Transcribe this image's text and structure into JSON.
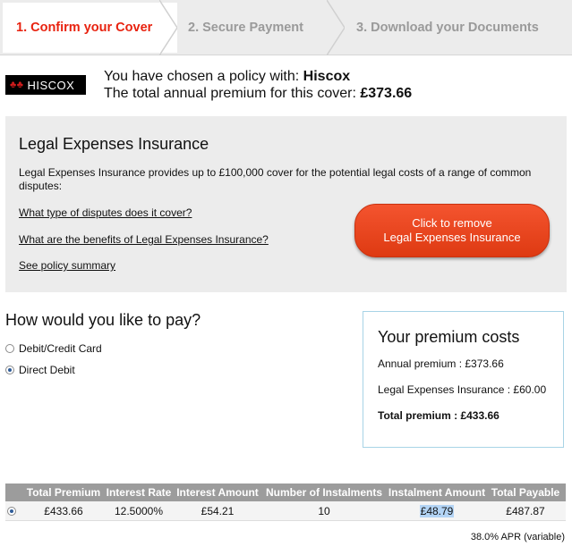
{
  "steps": [
    {
      "label": "1. Confirm your Cover",
      "active": true
    },
    {
      "label": "2. Secure Payment",
      "active": false
    },
    {
      "label": "3. Download your Documents",
      "active": false
    }
  ],
  "policy": {
    "logo_text": "HISCOX",
    "chosen_prefix": "You have chosen a policy with: ",
    "provider": "Hiscox",
    "premium_prefix": "The total annual premium for this cover: ",
    "premium": "£373.66"
  },
  "legal": {
    "title": "Legal Expenses Insurance",
    "description": "Legal Expenses Insurance provides up to £100,000 cover for the potential legal costs of a range of common disputes:",
    "links": [
      "What type of disputes does it cover?",
      "What are the benefits of Legal Expenses Insurance?",
      "See policy summary"
    ],
    "button_line1": "Click to remove",
    "button_line2": "Legal Expenses Insurance"
  },
  "payment": {
    "title": "How would you like to pay?",
    "options": [
      {
        "label": "Debit/Credit Card",
        "selected": false
      },
      {
        "label": "Direct Debit",
        "selected": true
      }
    ]
  },
  "costs": {
    "title": "Your premium costs",
    "annual": "Annual premium : £373.66",
    "legal": "Legal Expenses Insurance : £60.00",
    "total": "Total premium : £433.66"
  },
  "table": {
    "headers": [
      "Total Premium",
      "Interest Rate",
      "Interest Amount",
      "Number of Instalments",
      "Instalment Amount",
      "Total Payable"
    ],
    "row": [
      "£433.66",
      "12.5000%",
      "£54.21",
      "10",
      "£48.79",
      "£487.87"
    ],
    "apr": "38.0% APR (variable)"
  },
  "colors": {
    "accent": "#e8220f",
    "button": "#e84520",
    "box_border": "#a8d4e6"
  }
}
